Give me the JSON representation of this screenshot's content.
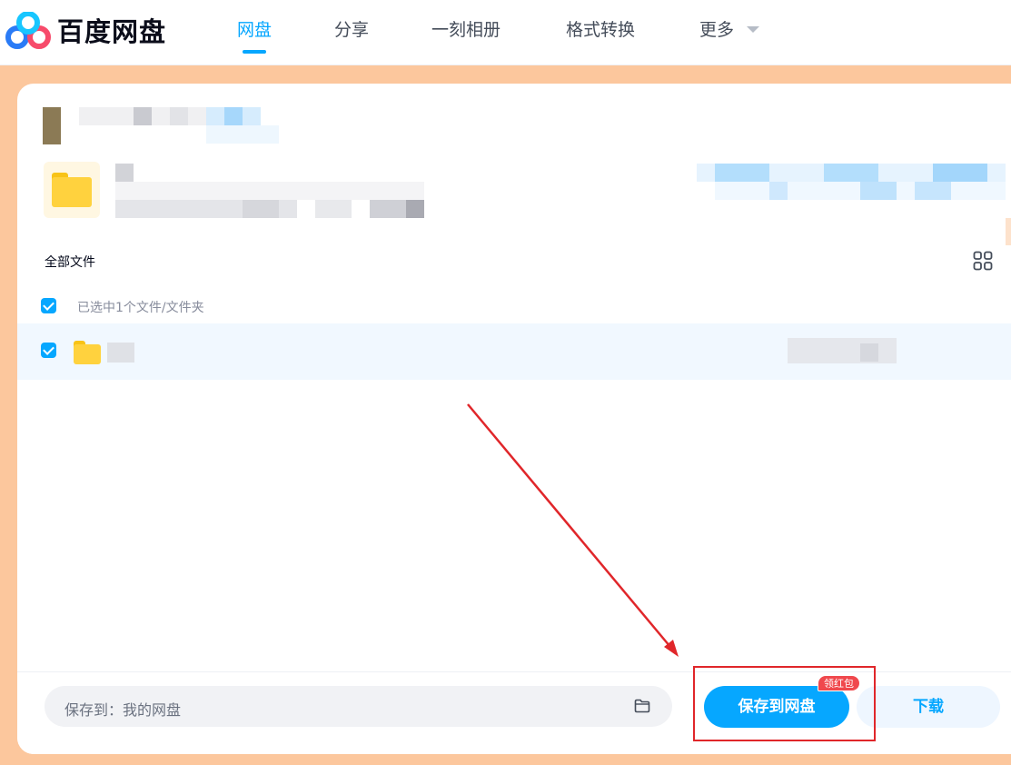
{
  "header": {
    "brand": "百度网盘",
    "nav": [
      {
        "label": "网盘",
        "active": true
      },
      {
        "label": "分享",
        "active": false
      },
      {
        "label": "一刻相册",
        "active": false
      },
      {
        "label": "格式转换",
        "active": false
      },
      {
        "label": "更多",
        "active": false
      }
    ]
  },
  "main": {
    "section_title": "全部文件",
    "selected_text": "已选中1个文件/文件夹",
    "select_all_checked": true,
    "file_row_checked": true
  },
  "bottom": {
    "save_path_label": "保存到：我的网盘",
    "save_button": "保存到网盘",
    "badge": "领红包",
    "download_button": "下载"
  },
  "icons": {
    "logo": "baidu-netdisk-logo",
    "more_caret": "caret-down-icon",
    "grid": "grid-view-icon",
    "folder": "folder-icon",
    "folder_outline": "folder-outline-icon"
  },
  "colors": {
    "accent": "#06a7ff",
    "badge": "#f0484d",
    "background": "#fcc79d",
    "annotation": "#e0262a"
  }
}
